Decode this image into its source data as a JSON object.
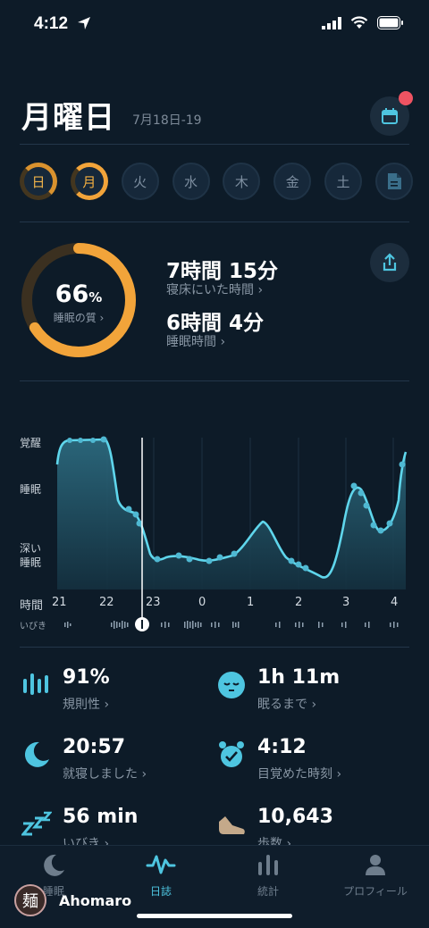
{
  "status": {
    "time": "4:12"
  },
  "header": {
    "day_title": "月曜日",
    "date_range": "7月18日-19"
  },
  "days": [
    "日",
    "月",
    "火",
    "水",
    "木",
    "金",
    "土"
  ],
  "summary": {
    "quality_value": "66",
    "quality_unit": "%",
    "quality_label": "睡眠の質 ›",
    "quality_fraction": 0.66,
    "in_bed_value": "7時間 15分",
    "in_bed_label": "寝床にいた時間 ›",
    "asleep_value": "6時間 4分",
    "asleep_label": "睡眠時間 ›"
  },
  "chart_data": {
    "type": "area",
    "y_levels": [
      "覚醒",
      "睡眠",
      "深い\n睡眠"
    ],
    "x_ticks": [
      "21",
      "22",
      "23",
      "0",
      "1",
      "2",
      "3",
      "4"
    ],
    "x_axis_label": "時間",
    "snore_label": "いびき"
  },
  "stats": {
    "regularity_value": "91%",
    "regularity_label": "規則性 ›",
    "fall_asleep_value": "1h 11m",
    "fall_asleep_label": "眠るまで ›",
    "bedtime_value": "20:57",
    "bedtime_label": "就寝しました ›",
    "wake_value": "4:12",
    "wake_label": "目覚めた時刻 ›",
    "snore_value": "56 min",
    "snore_label": "いびき ›",
    "steps_value": "10,643",
    "steps_label": "歩数 ›"
  },
  "tabs": [
    {
      "label": "睡眠"
    },
    {
      "label": "日誌"
    },
    {
      "label": "統計"
    },
    {
      "label": "プロフィール"
    }
  ],
  "watermark": {
    "logo_char": "麺",
    "name": "Ahomaro"
  },
  "colors": {
    "accent": "#4ec5e0",
    "orange": "#f2a43a",
    "background": "#0d1b28"
  }
}
